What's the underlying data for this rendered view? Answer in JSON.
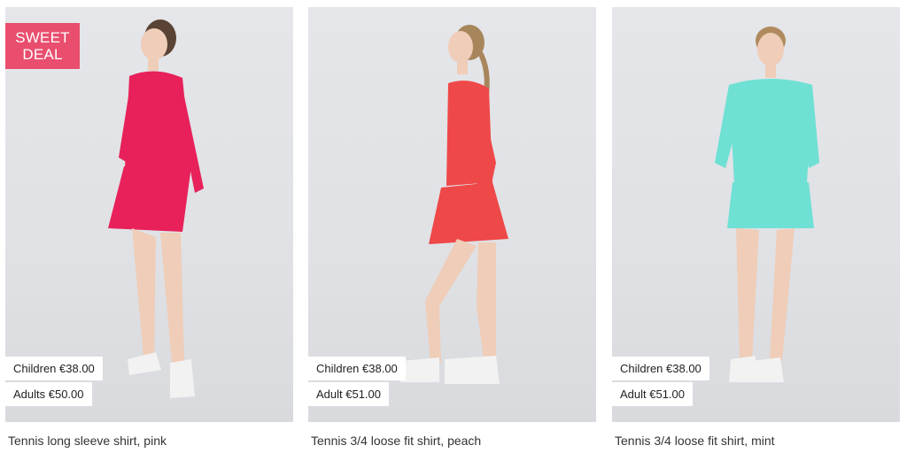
{
  "products": [
    {
      "badge": [
        "SWEET",
        "DEAL"
      ],
      "children_price": "Children €38.00",
      "adult_price": "Adults €50.00",
      "title": "Tennis long sleeve shirt, pink",
      "garment_color": "#e8215a"
    },
    {
      "children_price": "Children €38.00",
      "adult_price": "Adult €51.00",
      "title": "Tennis 3/4 loose fit shirt, peach",
      "garment_color": "#ef4848"
    },
    {
      "children_price": "Children €38.00",
      "adult_price": "Adult €51.00",
      "title": "Tennis 3/4 loose fit shirt, mint",
      "garment_color": "#6fe0d4"
    }
  ],
  "colors": {
    "badge": "#e94e6e",
    "skin": "#efcdb8",
    "shoe": "#f2f2f2"
  }
}
